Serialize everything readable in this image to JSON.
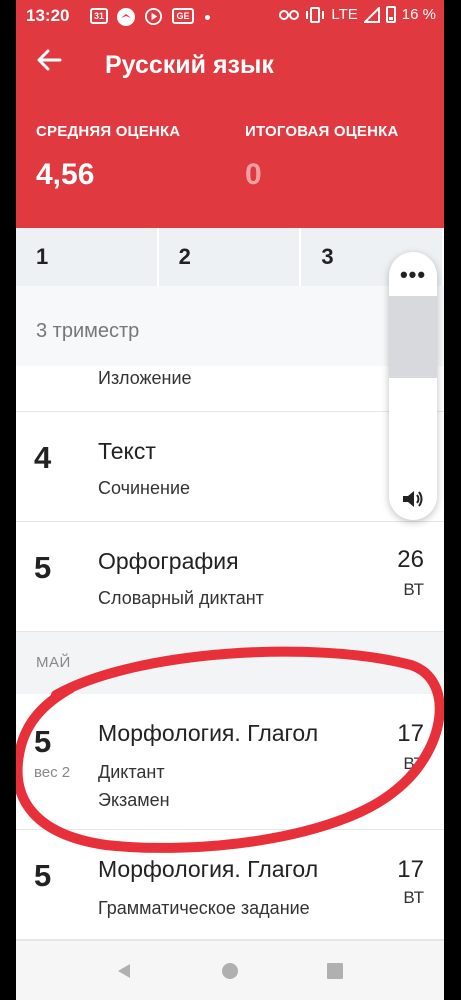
{
  "status": {
    "time": "13:20",
    "calendar_icon": "31",
    "news_icon": "GE",
    "network": "LTE",
    "battery": "16 %"
  },
  "header": {
    "title": "Русский язык",
    "avg_label": "СРЕДНЯЯ ОЦЕНКА",
    "avg_value": "4,56",
    "final_label": "ИТОГОВАЯ ОЦЕНКА",
    "final_value": "0"
  },
  "tabs": [
    "1",
    "2",
    "3"
  ],
  "term_label": "3 триместр",
  "rows_before": [
    {
      "grade": "",
      "subject": "",
      "kind": "Изложение",
      "day": "",
      "weekday": ""
    },
    {
      "grade": "4",
      "subject": "Текст",
      "kind": "Сочинение",
      "day": "",
      "weekday": ""
    },
    {
      "grade": "5",
      "subject": "Орфография",
      "kind": "Словарный диктант",
      "day": "26",
      "weekday": "ВТ"
    }
  ],
  "month_label": "МАЙ",
  "rows_may": [
    {
      "grade": "5",
      "weight": "вес 2",
      "subject": "Морфология. Глагол",
      "kind": "Диктант",
      "kind2": "Экзамен",
      "day": "17",
      "weekday": "ВТ"
    },
    {
      "grade": "5",
      "subject": "Морфология. Глагол",
      "kind": "Грамматическое задание",
      "day": "17",
      "weekday": "ВТ"
    }
  ],
  "volume_panel": {
    "menu_icon": "•••",
    "icon": "speaker-icon"
  },
  "colors": {
    "accent": "#e0393f",
    "annotation": "#e8303a"
  }
}
